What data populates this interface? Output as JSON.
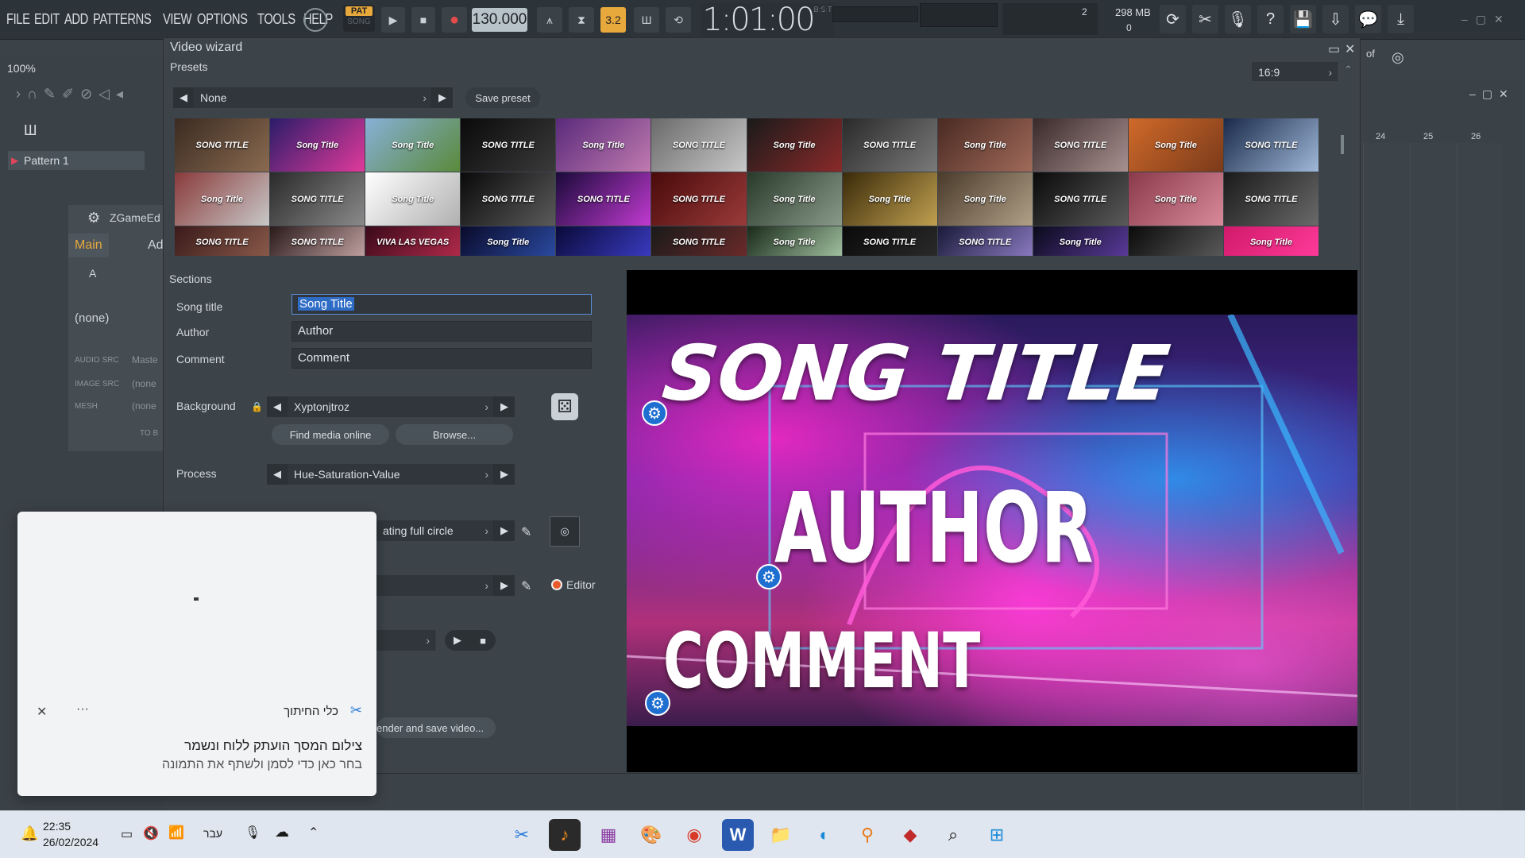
{
  "menu": [
    "FILE",
    "EDIT",
    "ADD",
    "PATTERNS",
    "VIEW",
    "OPTIONS",
    "TOOLS",
    "HELP"
  ],
  "transport": {
    "pat": "PAT",
    "song": "SONG",
    "tempo": "130.000",
    "time": "1:01:00",
    "time_label": "B:S:T",
    "snap_label": "3.2"
  },
  "memory": {
    "value": "298 MB",
    "cpu": "2",
    "voices": "0"
  },
  "browser": {
    "zoom": "100%",
    "pattern": "Pattern 1"
  },
  "zgame": {
    "title": "ZGameEd",
    "tab_main": "Main",
    "tab_ad": "Ad",
    "row_a": "A",
    "none": "(none)",
    "audio_src": "AUDIO SRC",
    "image_src": "IMAGE SRC",
    "mesh": "MESH",
    "master": "Maste",
    "none2": "(none",
    "none3": "(none",
    "to_b": "TO B"
  },
  "right": {
    "of": "of",
    "bars": [
      "24",
      "25",
      "26"
    ]
  },
  "wizard": {
    "title": "Video wizard",
    "presets_label": "Presets",
    "aspect": "16:9",
    "preset_value": "None",
    "save_preset": "Save preset",
    "sections_label": "Sections",
    "song_title_label": "Song title",
    "song_title_value": "Song Title",
    "author_label": "Author",
    "author_value": "Author",
    "comment_label": "Comment",
    "comment_value": "Comment",
    "background_label": "Background",
    "background_value": "Xyptonjtroz",
    "find_media": "Find media online",
    "browse": "Browse...",
    "process_label": "Process",
    "process_value": "Hue-Saturation-Value",
    "rotate_value": "ating full circle",
    "editor": "Editor",
    "render": "ender and save video..."
  },
  "thumbs": [
    {
      "t": "SONG TITLE",
      "c1": "#3a2b22",
      "c2": "#8a6a50"
    },
    {
      "t": "Song Title",
      "c1": "#2b1c6a",
      "c2": "#e03a9a"
    },
    {
      "t": "Song Title",
      "c1": "#88b0d8",
      "c2": "#5a8a3a"
    },
    {
      "t": "SONG TITLE",
      "c1": "#0a0a0a",
      "c2": "#3a3a3a"
    },
    {
      "t": "Song Title",
      "c1": "#5a2a7a",
      "c2": "#c07ab0"
    },
    {
      "t": "SONG TITLE",
      "c1": "#6a6a6a",
      "c2": "#c8c8c8"
    },
    {
      "t": "Song Title",
      "c1": "#1a1a1a",
      "c2": "#8a2a2a"
    },
    {
      "t": "SONG TITLE",
      "c1": "#2a2a2a",
      "c2": "#7a7a7a"
    },
    {
      "t": "Song Title",
      "c1": "#4a2a22",
      "c2": "#a06a5a"
    },
    {
      "t": "SONG TITLE",
      "c1": "#3a2a2a",
      "c2": "#a89090"
    },
    {
      "t": "Song Title",
      "c1": "#d06a2a",
      "c2": "#7a3a1a"
    },
    {
      "t": "SONG TITLE",
      "c1": "#1a2a4a",
      "c2": "#a0b8d8"
    },
    {
      "t": "Song Title",
      "c1": "#8a3a3a",
      "c2": "#c8c8c8"
    },
    {
      "t": "SONG TITLE",
      "c1": "#2a2a2a",
      "c2": "#8a8a8a"
    },
    {
      "t": "Song Title",
      "c1": "#ffffff",
      "c2": "#b0b0b0"
    },
    {
      "t": "SONG TITLE",
      "c1": "#0a0a0a",
      "c2": "#5a5a5a"
    },
    {
      "t": "SONG TITLE",
      "c1": "#1a0a3a",
      "c2": "#c03ad0"
    },
    {
      "t": "SONG TITLE",
      "c1": "#4a0a0a",
      "c2": "#9a3a3a"
    },
    {
      "t": "Song Title",
      "c1": "#2a3a2a",
      "c2": "#8a9a8a"
    },
    {
      "t": "Song Title",
      "c1": "#3a2a0a",
      "c2": "#c0a050"
    },
    {
      "t": "Song Title",
      "c1": "#4a3a2a",
      "c2": "#b0a088"
    },
    {
      "t": "SONG TITLE",
      "c1": "#0a0a0a",
      "c2": "#5a5a5a"
    },
    {
      "t": "Song Title",
      "c1": "#8a3a4a",
      "c2": "#d88a9a"
    },
    {
      "t": "SONG TITLE",
      "c1": "#1a1a1a",
      "c2": "#6a6a6a"
    },
    {
      "t": "SONG TITLE",
      "c1": "#3a1a1a",
      "c2": "#8a5a4a"
    },
    {
      "t": "SONG TITLE",
      "c1": "#2a1a1a",
      "c2": "#c0a0a0"
    },
    {
      "t": "VIVA LAS VEGAS",
      "c1": "#3a0a1a",
      "c2": "#b02a4a"
    },
    {
      "t": "Song Title",
      "c1": "#0a0a2a",
      "c2": "#2a4aa0"
    },
    {
      "t": "",
      "c1": "#0a0a3a",
      "c2": "#3a3ac0"
    },
    {
      "t": "SONG TITLE",
      "c1": "#1a1a1a",
      "c2": "#6a2a2a"
    },
    {
      "t": "Song Title",
      "c1": "#1a2a1a",
      "c2": "#a0c0a0"
    },
    {
      "t": "SONG TITLE",
      "c1": "#0a0a0a",
      "c2": "#2a2a2a"
    },
    {
      "t": "SONG TITLE",
      "c1": "#1a1a3a",
      "c2": "#8a7ac0"
    },
    {
      "t": "Song Title",
      "c1": "#0a0a1a",
      "c2": "#5a3a9a"
    },
    {
      "t": "",
      "c1": "#0a0a0a",
      "c2": "#5a5a5a"
    },
    {
      "t": "Song Title",
      "c1": "#d01a6a",
      "c2": "#ff3a9a"
    }
  ],
  "preview": {
    "title": "SONG TITLE",
    "author": "AUTHOR",
    "comment": "COMMENT"
  },
  "snip": {
    "app": "כלי החיתוך",
    "line1": "צילום המסך הועתק ללוח ונשמר",
    "line2": "בחר כאן כדי לסמן ולשתף את התמונה"
  },
  "taskbar": {
    "time": "22:35",
    "date": "26/02/2024",
    "lang": "עבר"
  }
}
